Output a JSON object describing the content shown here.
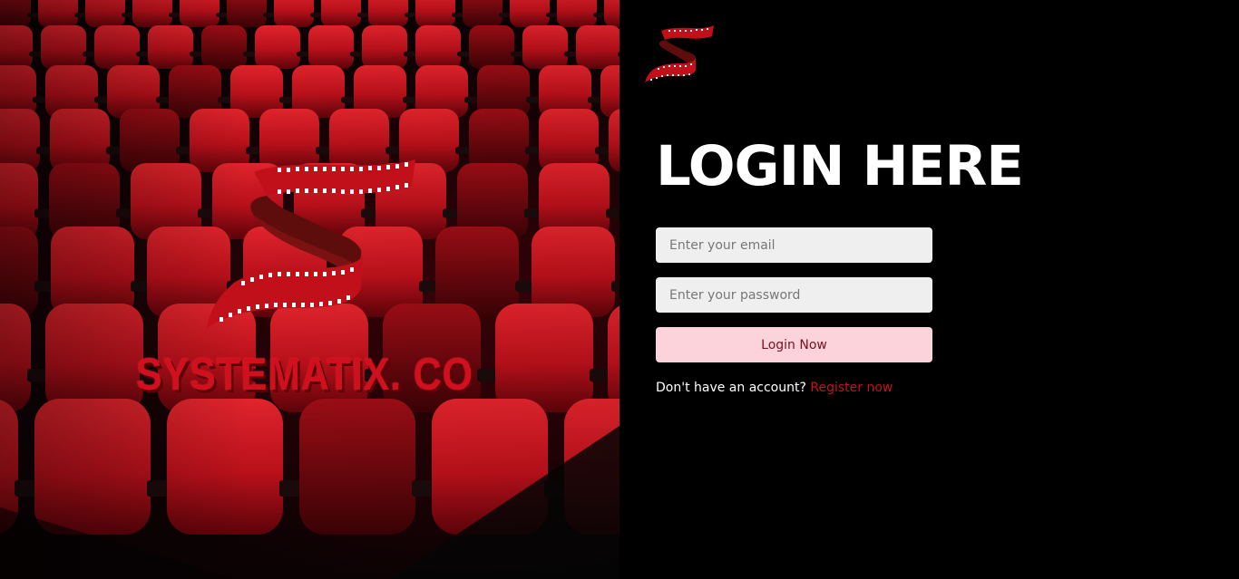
{
  "brand": {
    "name": "SYSTEMATIX. CO",
    "accent_color": "#d0101e",
    "logo_icon": "film-strip-s-logo"
  },
  "login": {
    "title": "LOGIN HERE",
    "email_placeholder": "Enter your email",
    "password_placeholder": "Enter your password",
    "submit_label": "Login Now",
    "register_prompt": "Don't have an account?",
    "register_link": "Register now"
  },
  "colors": {
    "background": "#000000",
    "button_bg": "#fdd3db",
    "link": "#c5121c"
  }
}
